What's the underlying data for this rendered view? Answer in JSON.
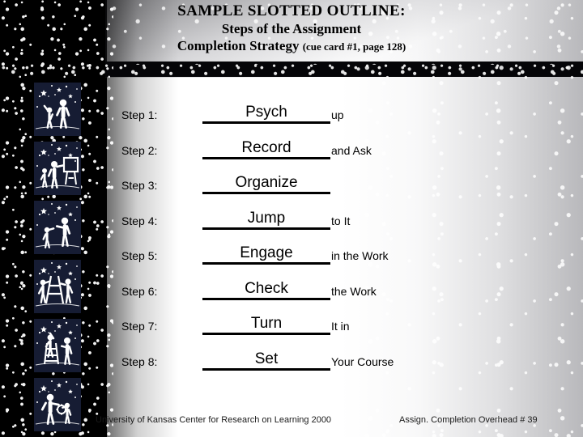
{
  "slide": {
    "title_line1": "SAMPLE SLOTTED OUTLINE:",
    "title_line2": "Steps of the Assignment",
    "title_line3": "Completion Strategy",
    "title_sub": "(cue card #1, page 128)"
  },
  "steps": [
    {
      "label": "Step 1:",
      "answer": "Psych",
      "tail": "up"
    },
    {
      "label": "Step 2:",
      "answer": "Record",
      "tail": "and Ask"
    },
    {
      "label": "Step 3:",
      "answer": "Organize",
      "tail": ""
    },
    {
      "label": "Step 4:",
      "answer": "Jump",
      "tail": "to It"
    },
    {
      "label": "Step 5:",
      "answer": "Engage",
      "tail": "in the Work"
    },
    {
      "label": "Step 6:",
      "answer": "Check",
      "tail": "the Work"
    },
    {
      "label": "Step 7:",
      "answer": "Turn",
      "tail": "It in"
    },
    {
      "label": "Step 8:",
      "answer": "Set",
      "tail": "Your Course"
    }
  ],
  "sidebar": {
    "tiles": [
      {
        "name": "icon-tile-pointing-figures"
      },
      {
        "name": "icon-tile-easel-figures"
      },
      {
        "name": "icon-tile-handoff-figures"
      },
      {
        "name": "icon-tile-ladder-pair-figures"
      },
      {
        "name": "icon-tile-ladder-climb-figures"
      },
      {
        "name": "icon-tile-gear-handoff-figures"
      }
    ]
  },
  "footer": {
    "left": "University of Kansas Center for Research on Learning  2000",
    "right": "Assign. Completion Overhead #  39"
  },
  "colors": {
    "tile_navy": "#161c33",
    "ink": "#000000",
    "star_white": "#ffffff"
  }
}
